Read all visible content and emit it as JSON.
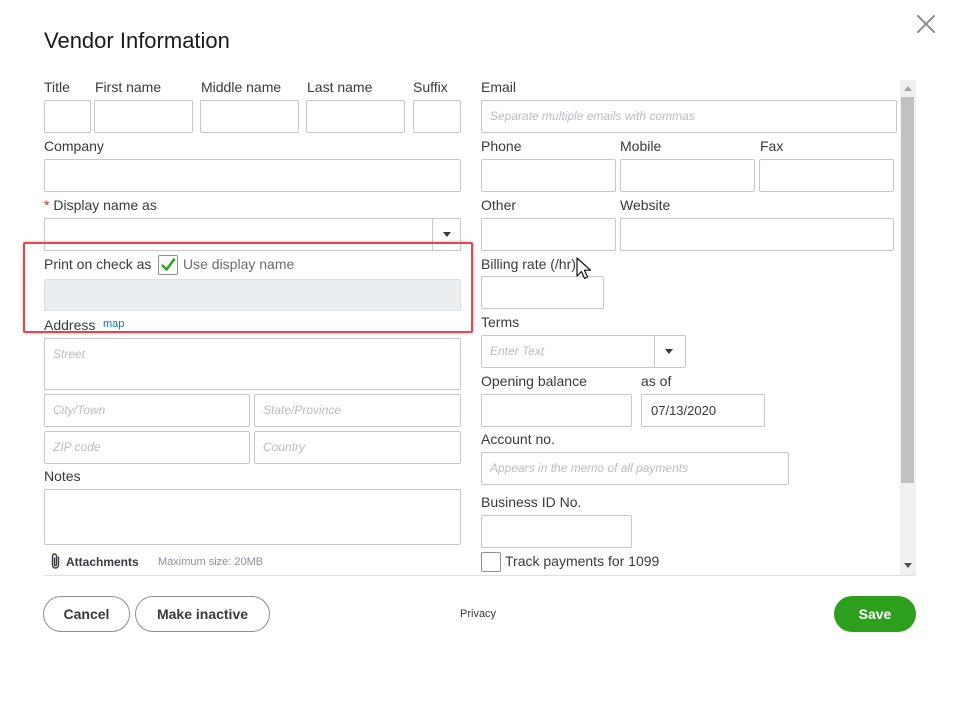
{
  "dialog": {
    "title": "Vendor Information"
  },
  "name_row": {
    "title_label": "Title",
    "first_label": "First name",
    "middle_label": "Middle name",
    "last_label": "Last name",
    "suffix_label": "Suffix"
  },
  "company_label": "Company",
  "display_name": {
    "required_mark": "*",
    "label": "Display name as"
  },
  "print_on_check": {
    "label": "Print on check as",
    "checkbox_label": "Use display name",
    "checked": true
  },
  "address": {
    "label": "Address",
    "map_link": "map",
    "street_placeholder": "Street",
    "city_placeholder": "City/Town",
    "state_placeholder": "State/Province",
    "zip_placeholder": "ZIP code",
    "country_placeholder": "Country"
  },
  "notes_label": "Notes",
  "attachments": {
    "label": "Attachments",
    "max_size": "Maximum size: 20MB"
  },
  "email": {
    "label": "Email",
    "placeholder": "Separate multiple emails with commas"
  },
  "phone_row": {
    "phone_label": "Phone",
    "mobile_label": "Mobile",
    "fax_label": "Fax"
  },
  "other_row": {
    "other_label": "Other",
    "website_label": "Website"
  },
  "billing_rate_label": "Billing rate (/hr)",
  "terms": {
    "label": "Terms",
    "placeholder": "Enter Text"
  },
  "opening_balance": {
    "label": "Opening balance",
    "as_of_label": "as of",
    "date_value": "07/13/2020"
  },
  "account_no": {
    "label": "Account no.",
    "placeholder": "Appears in the memo of all payments"
  },
  "business_id_label": "Business ID No.",
  "track_1099": {
    "label": "Track payments for 1099",
    "checked": false
  },
  "footer": {
    "cancel": "Cancel",
    "make_inactive": "Make inactive",
    "privacy": "Privacy",
    "save": "Save"
  },
  "colors": {
    "save_green": "#2ca01c",
    "link_blue": "#0077c5",
    "highlight_red": "#e0484d",
    "check_green": "#2ca01c"
  },
  "icons": {
    "close": "close-icon",
    "checkmark": "checkmark-icon",
    "paperclip": "paperclip-icon",
    "dropdown": "chevron-down-icon",
    "cursor": "pointer-cursor-icon"
  }
}
